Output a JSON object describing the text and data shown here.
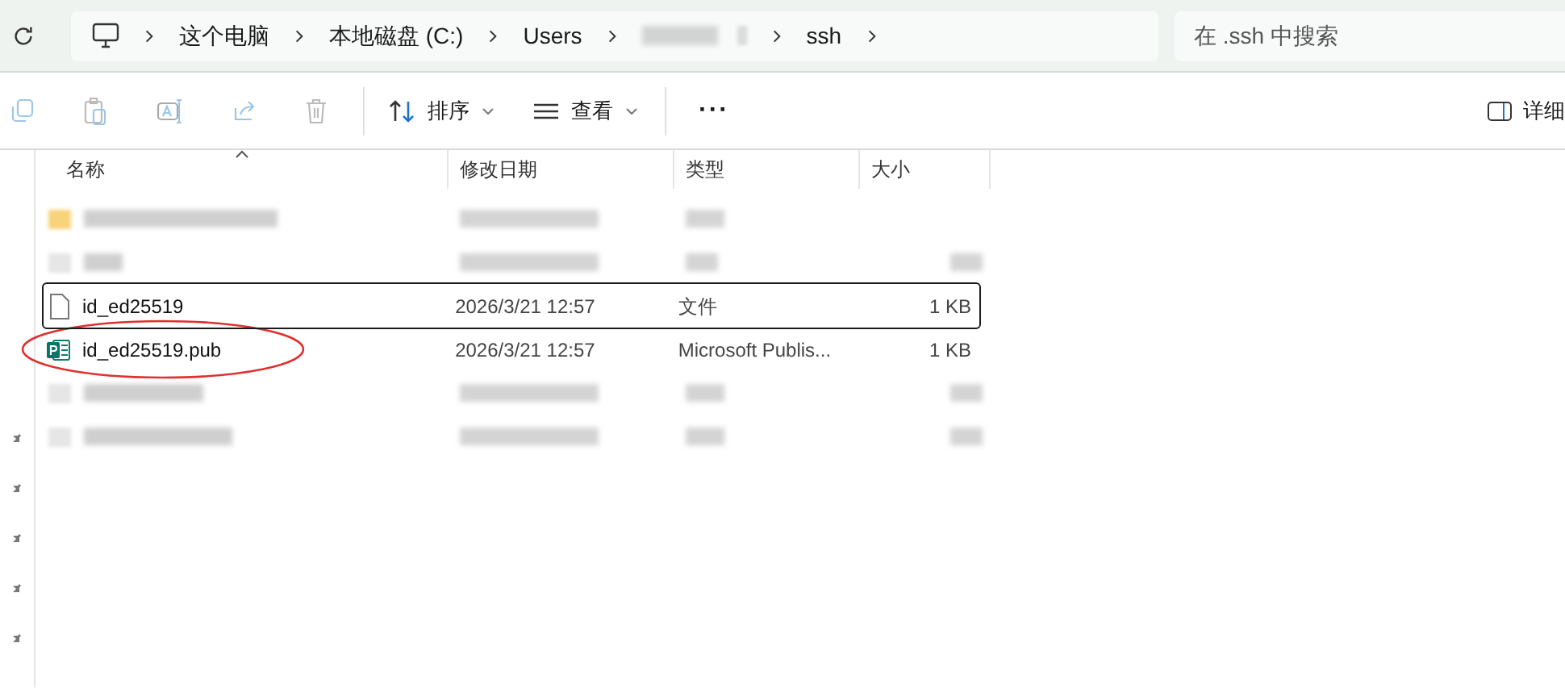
{
  "address_bar": {
    "segments": [
      {
        "kind": "text",
        "label": "这个电脑"
      },
      {
        "kind": "text",
        "label": "本地磁盘 (C:)"
      },
      {
        "kind": "text",
        "label": "Users"
      },
      {
        "kind": "redacted"
      },
      {
        "kind": "text",
        "label": "ssh"
      }
    ]
  },
  "search": {
    "placeholder": "在 .ssh 中搜索"
  },
  "toolbar": {
    "sort_label": "排序",
    "view_label": "查看",
    "more_label": "···",
    "details_label": "详细"
  },
  "table": {
    "columns": [
      {
        "label": "名称",
        "sorted": true
      },
      {
        "label": "修改日期",
        "sorted": false
      },
      {
        "label": "类型",
        "sorted": false
      },
      {
        "label": "大小",
        "sorted": false
      }
    ],
    "rows": [
      {
        "kind": "redacted_folder"
      },
      {
        "kind": "redacted"
      },
      {
        "kind": "file",
        "name": "id_ed25519",
        "date": "2026/3/21 12:57",
        "type": "文件",
        "size": "1 KB",
        "focused": true,
        "circled": false
      },
      {
        "kind": "publisher_file",
        "name": "id_ed25519.pub",
        "date": "2026/3/21 12:57",
        "type": "Microsoft Publis...",
        "size": "1 KB",
        "focused": false,
        "circled": true
      },
      {
        "kind": "redacted"
      },
      {
        "kind": "redacted"
      }
    ]
  }
}
